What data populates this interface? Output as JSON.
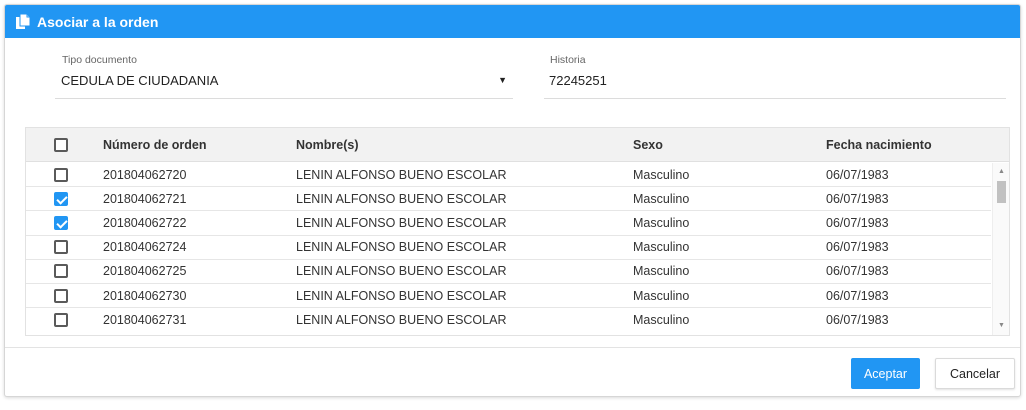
{
  "dialog": {
    "title": "Asociar a la orden",
    "title_icon": "copy-document-icon"
  },
  "form": {
    "tipo_documento": {
      "label": "Tipo documento",
      "value": "CEDULA DE CIUDADANIA"
    },
    "historia": {
      "label": "Historia",
      "value": "72245251"
    }
  },
  "grid": {
    "headers": {
      "numero": "Número de orden",
      "nombre": "Nombre(s)",
      "sexo": "Sexo",
      "fecha": "Fecha nacimiento"
    },
    "rows": [
      {
        "checked": false,
        "numero": "201804062720",
        "nombre": "LENIN ALFONSO BUENO ESCOLAR",
        "sexo": "Masculino",
        "fecha": "06/07/1983"
      },
      {
        "checked": true,
        "numero": "201804062721",
        "nombre": "LENIN ALFONSO BUENO ESCOLAR",
        "sexo": "Masculino",
        "fecha": "06/07/1983"
      },
      {
        "checked": true,
        "numero": "201804062722",
        "nombre": "LENIN ALFONSO BUENO ESCOLAR",
        "sexo": "Masculino",
        "fecha": "06/07/1983"
      },
      {
        "checked": false,
        "numero": "201804062724",
        "nombre": "LENIN ALFONSO BUENO ESCOLAR",
        "sexo": "Masculino",
        "fecha": "06/07/1983"
      },
      {
        "checked": false,
        "numero": "201804062725",
        "nombre": "LENIN ALFONSO BUENO ESCOLAR",
        "sexo": "Masculino",
        "fecha": "06/07/1983"
      },
      {
        "checked": false,
        "numero": "201804062730",
        "nombre": "LENIN ALFONSO BUENO ESCOLAR",
        "sexo": "Masculino",
        "fecha": "06/07/1983"
      },
      {
        "checked": false,
        "numero": "201804062731",
        "nombre": "LENIN ALFONSO BUENO ESCOLAR",
        "sexo": "Masculino",
        "fecha": "06/07/1983"
      }
    ]
  },
  "buttons": {
    "accept": "Aceptar",
    "cancel": "Cancelar"
  },
  "colors": {
    "accent": "#2196f3",
    "checkbox_checked": "#2196f3"
  }
}
